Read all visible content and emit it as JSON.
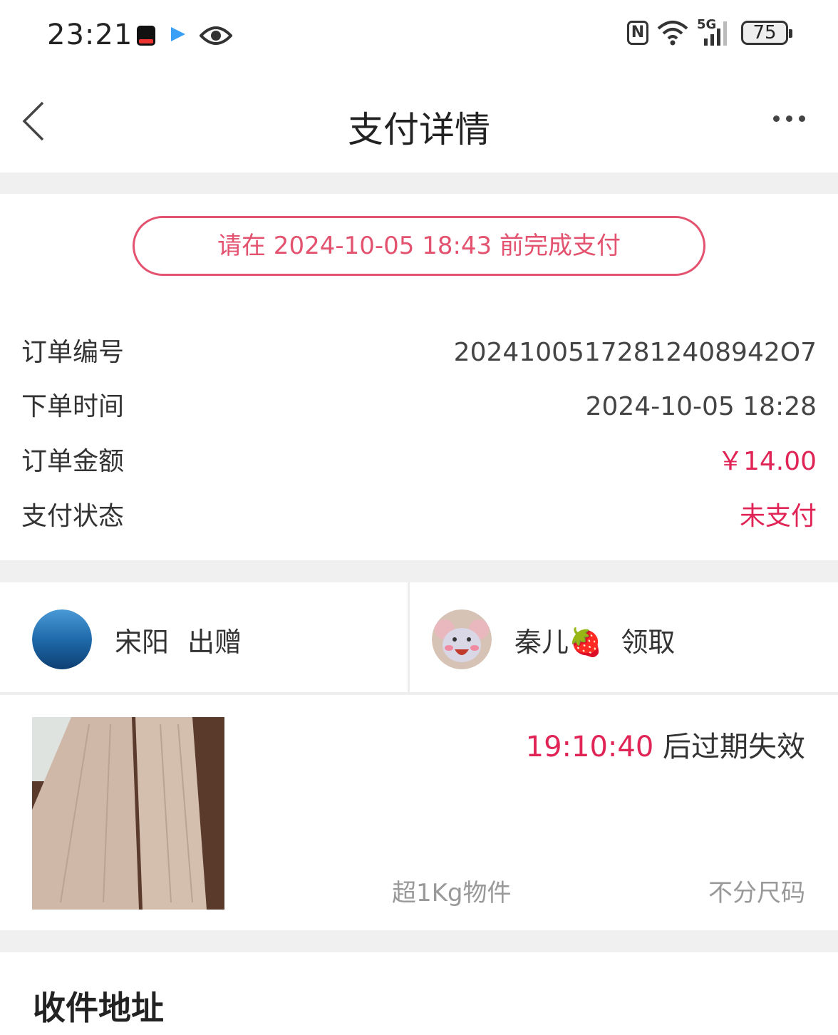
{
  "status_bar": {
    "time": "23:21",
    "network": "5G",
    "battery": "75",
    "icons": [
      "tiktok-lite-icon",
      "media-arrow-icon",
      "eye-icon",
      "nfc-icon",
      "wifi-icon",
      "signal-icon",
      "battery-icon"
    ]
  },
  "header": {
    "title": "支付详情",
    "back_icon": "chevron-left-icon",
    "more_icon": "more-dots-icon"
  },
  "payment_deadline": "请在 2024-10-05 18:43 前完成支付",
  "order": {
    "rows": [
      {
        "label": "订单编号",
        "value": "20241005172812408942O7"
      },
      {
        "label": "下单时间",
        "value": "2024-10-05 18:28"
      },
      {
        "label": "订单金额",
        "value": "￥14.00"
      },
      {
        "label": "支付状态",
        "value": "未支付"
      }
    ]
  },
  "giver": {
    "name": "宋阳",
    "action": "出赠"
  },
  "receiver": {
    "name": "秦儿🍓",
    "action": "领取"
  },
  "item": {
    "countdown": "19:10:40",
    "expire_suffix": " 后过期失效",
    "weight_tag": "超1Kg物件",
    "size_tag": "不分尺码"
  },
  "address": {
    "title": "收件地址"
  },
  "colors": {
    "accent": "#e02456",
    "pill_border": "#e3536f",
    "background": "#f0f0f0"
  }
}
